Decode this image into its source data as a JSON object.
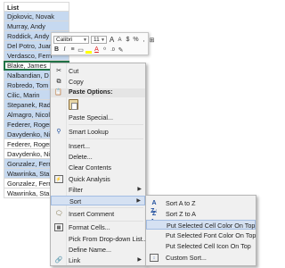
{
  "sheet": {
    "header": "List",
    "rows": [
      {
        "value": "Djokovic, Novak",
        "state": "sel"
      },
      {
        "value": "Murray, Andy",
        "state": "sel"
      },
      {
        "value": "Roddick, Andy",
        "state": "sel"
      },
      {
        "value": "Del Potro, Juan",
        "state": "sel"
      },
      {
        "value": "Verdasco, Fern",
        "state": "sel"
      },
      {
        "value": "Blake, James",
        "state": "active"
      },
      {
        "value": "Nalbandian, D",
        "state": "sel"
      },
      {
        "value": "Robredo, Tom",
        "state": "sel"
      },
      {
        "value": "Cilic, Marin",
        "state": "sel"
      },
      {
        "value": "Stepanek, Rad",
        "state": "sel"
      },
      {
        "value": "Almagro, Nicol",
        "state": "sel"
      },
      {
        "value": "Federer, Roger",
        "state": "sel"
      },
      {
        "value": "Davydenko, Ni",
        "state": "sel"
      },
      {
        "value": "Federer, Roger",
        "state": "white"
      },
      {
        "value": "Davydenko, Ni",
        "state": "white"
      },
      {
        "value": "Gonzalez, Ferr",
        "state": "sel"
      },
      {
        "value": "Wawrinka, Sta",
        "state": "sel"
      },
      {
        "value": "Gonzalez, Ferr",
        "state": "white"
      },
      {
        "value": "Wawrinka, Sta",
        "state": "white"
      }
    ]
  },
  "mini_toolbar": {
    "font_name": "Calibri",
    "font_size": "11",
    "row1_icons": [
      "A",
      "A",
      "$",
      "%",
      ",",
      "⊞"
    ],
    "row2_icons": [
      "B",
      "I",
      "≡",
      "▭",
      "A",
      "⁰",
      ".0",
      "✎"
    ]
  },
  "context_menu": {
    "cut": "Cut",
    "copy": "Copy",
    "paste_options": "Paste Options:",
    "paste_special": "Paste Special...",
    "smart_lookup": "Smart Lookup",
    "insert": "Insert...",
    "delete": "Delete...",
    "clear_contents": "Clear Contents",
    "quick_analysis": "Quick Analysis",
    "filter": "Filter",
    "sort": "Sort",
    "insert_comment": "Insert Comment",
    "format_cells": "Format Cells...",
    "pick_from_list": "Pick From Drop-down List...",
    "define_name": "Define Name...",
    "link": "Link"
  },
  "sort_submenu": {
    "a_to_z": "Sort A to Z",
    "z_to_a": "Sort Z to A",
    "cell_color": "Put Selected Cell Color On Top",
    "font_color": "Put Selected Font Color On Top",
    "cell_icon": "Put Selected Cell Icon On Top",
    "custom_sort": "Custom Sort..."
  },
  "colors": {
    "selection": "#c6d9f0",
    "highlight": "#d5e1f2",
    "accent_green": "#217346",
    "font_red": "#e02020"
  }
}
